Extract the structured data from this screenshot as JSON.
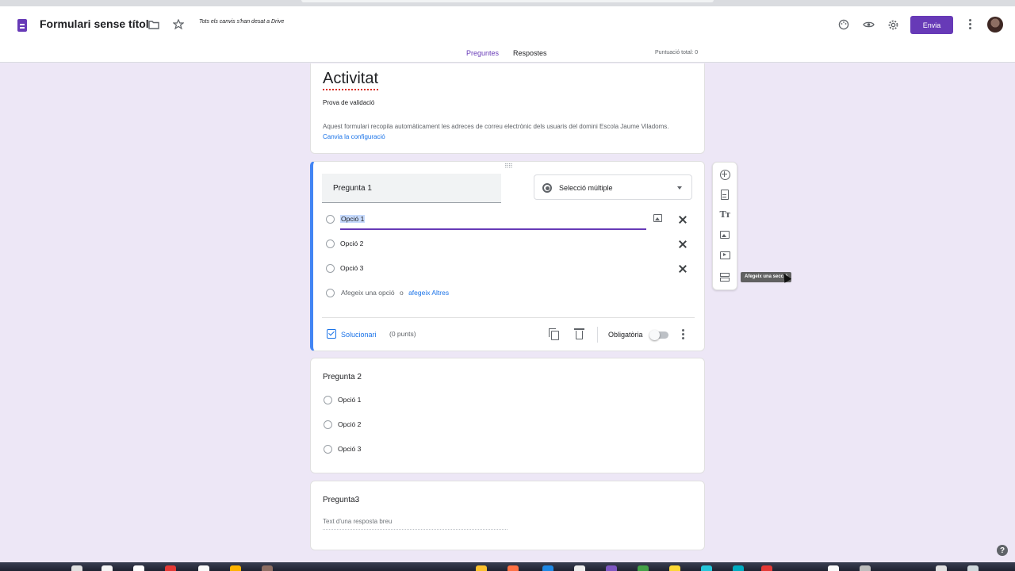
{
  "app": {
    "title": "Formulari sense títol",
    "save_status": "Tots els canvis s'han desat a Drive",
    "send_label": "Envia",
    "toolbar_icons": [
      "folder-icon",
      "star-icon",
      "palette-icon",
      "preview-eye-icon",
      "settings-gear-icon",
      "more-vert-icon"
    ]
  },
  "tabs": [
    {
      "label": "Preguntes",
      "active": true
    },
    {
      "label": "Respostes",
      "active": false
    }
  ],
  "total_score": "Puntuació total: 0",
  "header": {
    "title": "Activitat",
    "description": "Prova de validació",
    "note": "Aquest formulari recopila automàticament les adreces de correu electrònic dels usuaris del domini Escola Jaume Viladoms.",
    "note_link": "Canvia la configuració"
  },
  "question1": {
    "title": "Pregunta 1",
    "type": "Selecció múltiple",
    "options": [
      "Opció 1",
      "Opció 2",
      "Opció 3"
    ],
    "add_option": "Afegeix una opció",
    "or": "o",
    "add_other": "afegeix Altres",
    "answer_key": "Solucionari",
    "points": "(0 punts)",
    "required": "Obligatòria",
    "required_on": false
  },
  "question2": {
    "title": "Pregunta 2",
    "options": [
      "Opció 1",
      "Opció 2",
      "Opció 3"
    ]
  },
  "question3": {
    "title": "Pregunta3",
    "placeholder": "Text d'una resposta breu"
  },
  "sidebar": {
    "items": [
      "add-question-icon",
      "import-questions-icon",
      "add-title-icon",
      "add-image-icon",
      "add-video-icon",
      "add-section-icon"
    ],
    "tooltip": "Afegeix una secció"
  },
  "colors": {
    "accent": "#673ab7",
    "active_border": "#4285f4",
    "link": "#1a73e8",
    "background": "#ede7f6"
  }
}
